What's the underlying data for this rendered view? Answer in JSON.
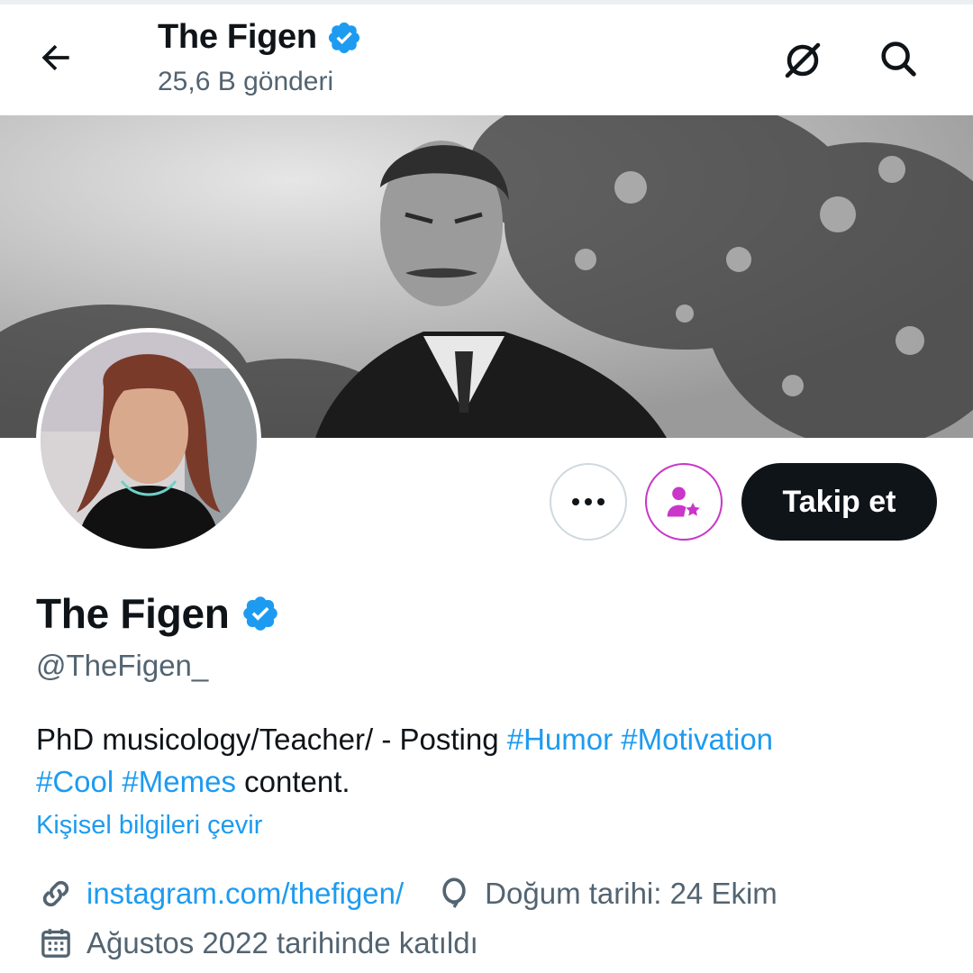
{
  "header": {
    "title": "The Figen",
    "post_count": "25,6 B gönderi",
    "back_icon": "arrow-left-icon",
    "grok_icon": "grok-icon",
    "search_icon": "search-icon"
  },
  "profile": {
    "display_name": "The Figen",
    "handle": "@TheFigen_",
    "verified_color": "#1d9bf0",
    "bio": {
      "text_1": "PhD musicology/Teacher/  -  Posting ",
      "tag_humor": "#Humor",
      "tag_motivation": "#Motivation",
      "tag_cool": "#Cool",
      "tag_memes": "#Memes",
      "text_2": " content."
    },
    "translate_label": "Kişisel bilgileri çevir",
    "website": "instagram.com/thefigen/",
    "birthday": "Doğum tarihi: 24 Ekim",
    "joined": "Ağustos 2022 tarihinde katıldı"
  },
  "actions": {
    "more_icon": "more-dots-icon",
    "subscribe_icon": "subscribe-star-icon",
    "follow_label": "Takip et"
  },
  "colors": {
    "accent": "#1d9bf0",
    "text": "#0f1419",
    "muted": "#536471",
    "subscribe": "#c936c9"
  }
}
